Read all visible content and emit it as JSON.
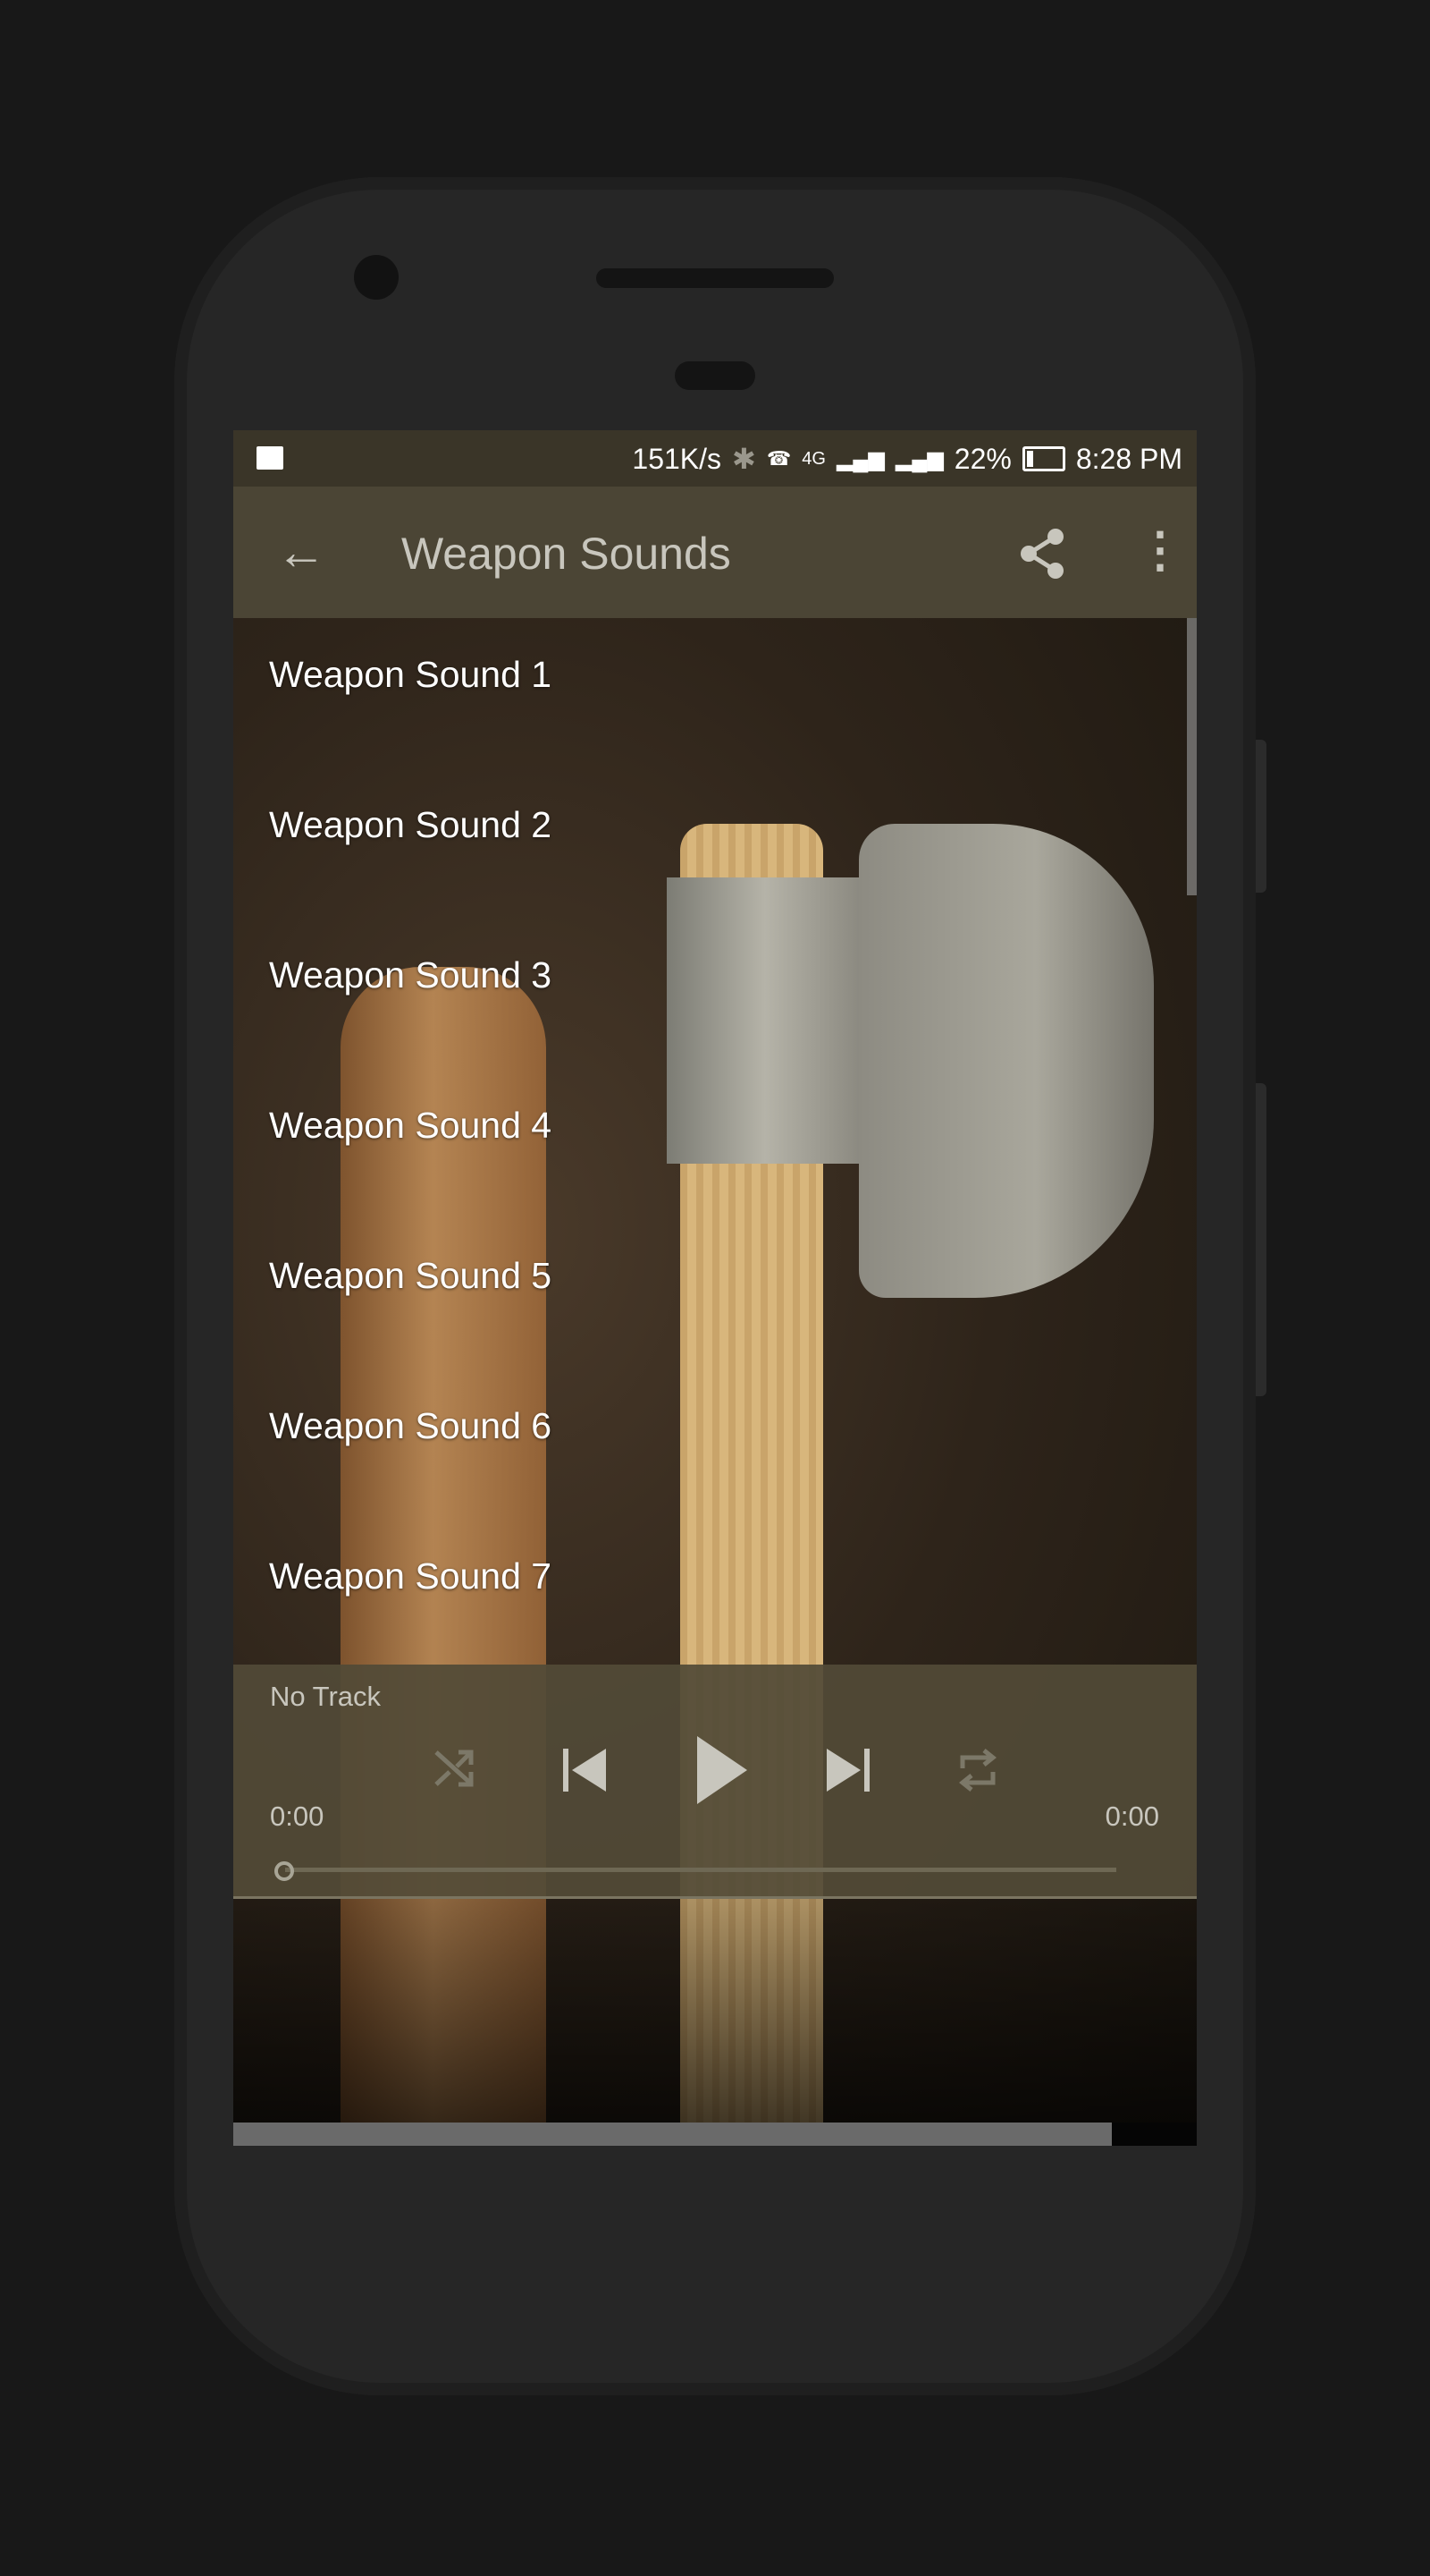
{
  "status_bar": {
    "net_speed": "151K/s",
    "network": "4G",
    "battery": "22%",
    "time": "8:28 PM",
    "icons": [
      "image-icon",
      "bluetooth-icon",
      "hd-call-icon",
      "signal-icon",
      "battery-icon"
    ]
  },
  "toolbar": {
    "title": "Weapon Sounds",
    "back_icon": "arrow-left-icon",
    "share_icon": "share-icon",
    "more_icon": "more-vert-icon"
  },
  "list": {
    "items": [
      {
        "label": "Weapon Sound 1"
      },
      {
        "label": "Weapon Sound 2"
      },
      {
        "label": "Weapon Sound 3"
      },
      {
        "label": "Weapon Sound 4"
      },
      {
        "label": "Weapon Sound 5"
      },
      {
        "label": "Weapon Sound 6"
      },
      {
        "label": "Weapon Sound 7"
      }
    ]
  },
  "player": {
    "track": "No Track",
    "elapsed": "0:00",
    "duration": "0:00",
    "progress": 0,
    "controls": [
      "shuffle-icon",
      "skip-previous-icon",
      "play-icon",
      "skip-next-icon",
      "repeat-icon"
    ]
  },
  "colors": {
    "status_bar": "#3a3528",
    "toolbar": "#4b4535",
    "player": "#524a37",
    "text_muted": "#c8c6bd"
  }
}
